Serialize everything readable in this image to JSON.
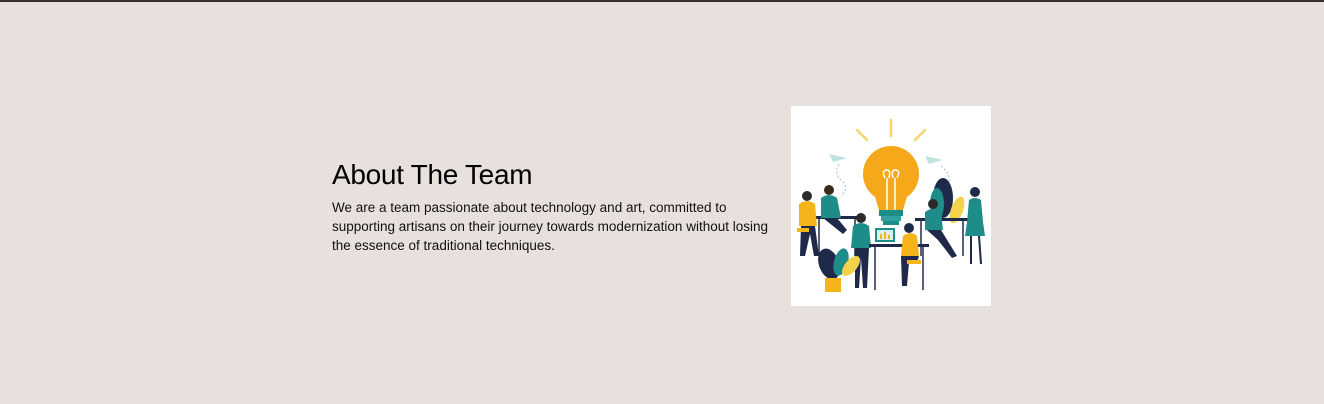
{
  "about": {
    "title": "About The Team",
    "description": "We are a team passionate about technology and art, committed to supporting artisans on their journey towards modernization without losing the essence of traditional techniques."
  },
  "illustration": {
    "icon": "team-lightbulb-illustration"
  },
  "colors": {
    "page_background": "#e8e0dc",
    "text": "#000000",
    "accent_yellow": "#f4b41a",
    "accent_teal": "#1e8c88",
    "navy": "#1f2a4a"
  }
}
